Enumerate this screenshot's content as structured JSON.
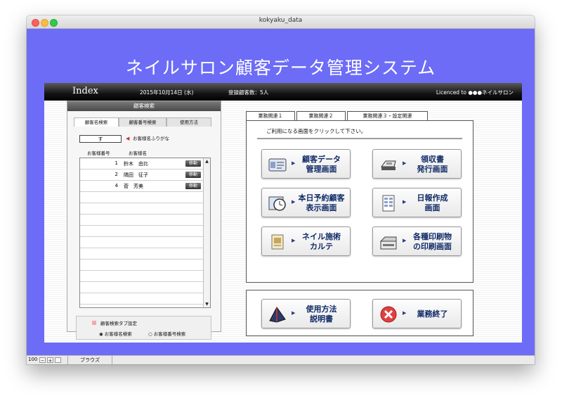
{
  "window": {
    "title": "kokyaku_data"
  },
  "app_title": "ネイルサロン顧客データ管理システム",
  "header": {
    "index": "Index",
    "date": "2015年10月14日 (水)",
    "count": "登録顧客数：5人",
    "licence": "Licenced to ●●●ネイルサロン"
  },
  "search": {
    "heading": "顧客検索",
    "tabs": [
      "顧客名検索",
      "顧客番号検索",
      "使用方法"
    ],
    "kana_value": "す",
    "kana_label": "お客様名ふりがな",
    "columns": [
      "お客様番号",
      "お客様名"
    ],
    "rows": [
      {
        "no": "1",
        "name": "鈴木　由比",
        "move": "移動"
      },
      {
        "no": "2",
        "name": "隅田　征子",
        "move": "移動"
      },
      {
        "no": "4",
        "name": "菅　芳美",
        "move": "移動"
      }
    ],
    "setting": {
      "label": "顧客検索タブ設定",
      "option_name": "◉ お客様名検索",
      "option_number": "○ お客様番号検索"
    }
  },
  "tasks": {
    "tabs": [
      "業務関連１",
      "業務関連２",
      "業務関連３・設定関連"
    ],
    "instruction": "ご利用になる画面をクリックして下さい。",
    "buttons": {
      "customer_line1": "顧客データ",
      "customer_line2": "管理画面",
      "receipt_line1": "領収書",
      "receipt_line2": "発行画面",
      "today_line1": "本日予約顧客",
      "today_line2": "表示画面",
      "daily_line1": "日報作成",
      "daily_line2": "画面",
      "nail_line1": "ネイル施術",
      "nail_line2": "カルテ",
      "print_line1": "各種印刷物",
      "print_line2": "の印刷画面",
      "manual_line1": "使用方法",
      "manual_line2": "説明書",
      "exit": "業務終了"
    }
  },
  "status": {
    "zoom": "100",
    "mode": "ブラウズ"
  },
  "colors": {
    "background": "#6d6cf7",
    "header": "#000000",
    "accent_text": "#0f2a66"
  }
}
